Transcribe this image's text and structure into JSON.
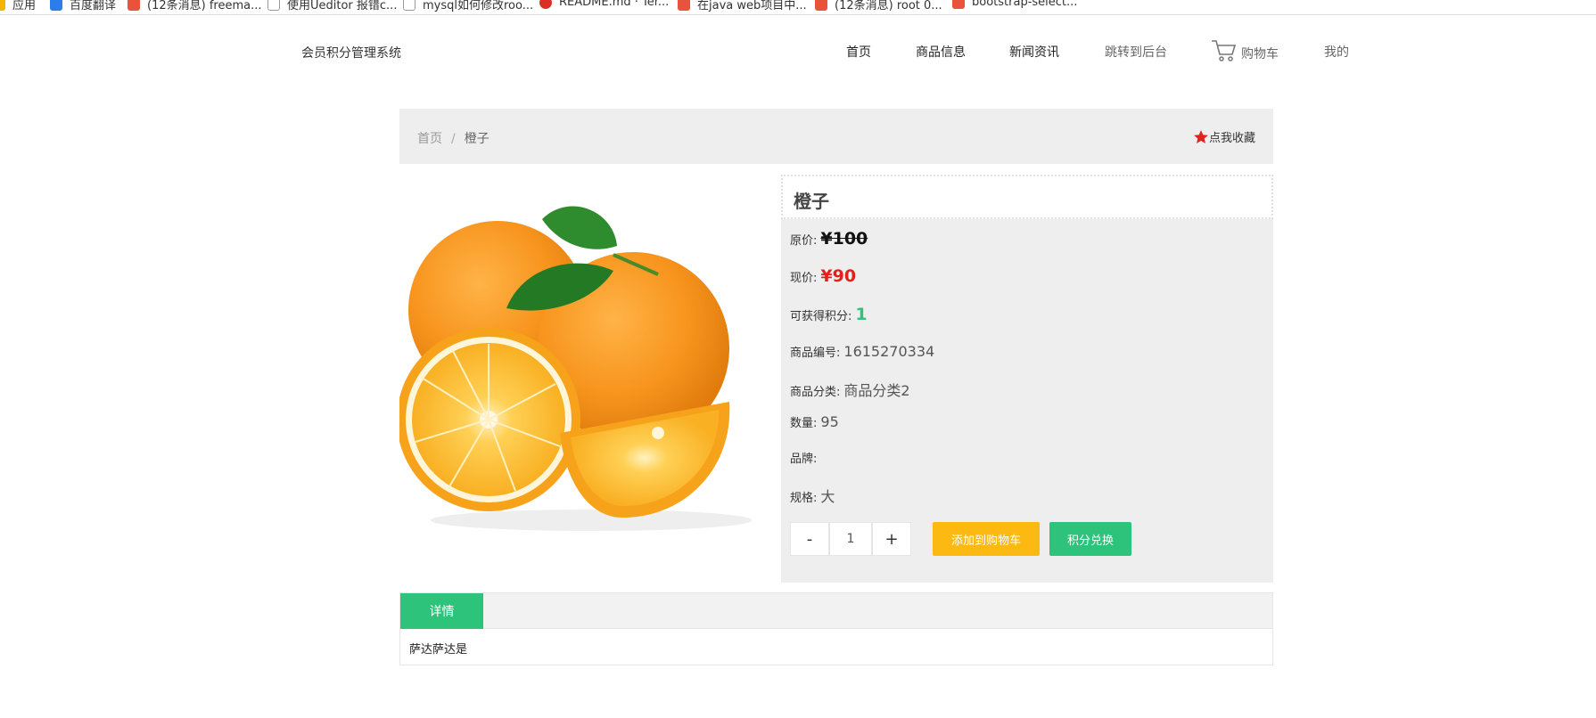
{
  "bookmarks": [
    {
      "label": "应用",
      "color": "#f4b400"
    },
    {
      "label": "百度翻译",
      "color": "#2b7de9"
    },
    {
      "label": "(12条消息) freema...",
      "color": "#e8533c"
    },
    {
      "label": "使用Ueditor 报错c...",
      "color": "#999999"
    },
    {
      "label": "mysql如何修改roo...",
      "color": "#999999"
    },
    {
      "label": "README.md · Ter...",
      "color": "#d93025"
    },
    {
      "label": "在java web项目中...",
      "color": "#e8533c"
    },
    {
      "label": "(12条消息) root 0...",
      "color": "#e8533c"
    },
    {
      "label": "bootstrap-select...",
      "color": "#e8533c"
    }
  ],
  "header": {
    "brand": "会员积分管理系统",
    "nav": [
      "首页",
      "商品信息",
      "新闻资讯",
      "跳转到后台"
    ],
    "cart_label": "购物车",
    "mine_label": "我的"
  },
  "breadcrumb": {
    "home": "首页",
    "separator": "/",
    "current": "橙子",
    "favorite_label": "点我收藏",
    "favorite_color": "#e4201c"
  },
  "product": {
    "title": "橙子",
    "original_price_label": "原价:",
    "original_price": "¥100",
    "current_price_label": "现价:",
    "current_price": "¥90",
    "points_label": "可获得积分:",
    "points": "1",
    "code_label": "商品编号:",
    "code": "1615270334",
    "category_label": "商品分类:",
    "category": "商品分类2",
    "quantity_label": "数量:",
    "quantity": "95",
    "brand_label": "品牌:",
    "brand": "",
    "spec_label": "规格:",
    "spec": "大",
    "image_icon": "orange-fruit-image"
  },
  "purchase": {
    "minus": "-",
    "qty": "1",
    "plus": "+",
    "add_to_cart": "添加到购物车",
    "exchange": "积分兑换"
  },
  "tabs": {
    "active": "详情",
    "content": "萨达萨达是"
  },
  "colors": {
    "accent_green": "#2ec37b",
    "accent_yellow": "#fbb911",
    "price_red": "#e4201c"
  }
}
